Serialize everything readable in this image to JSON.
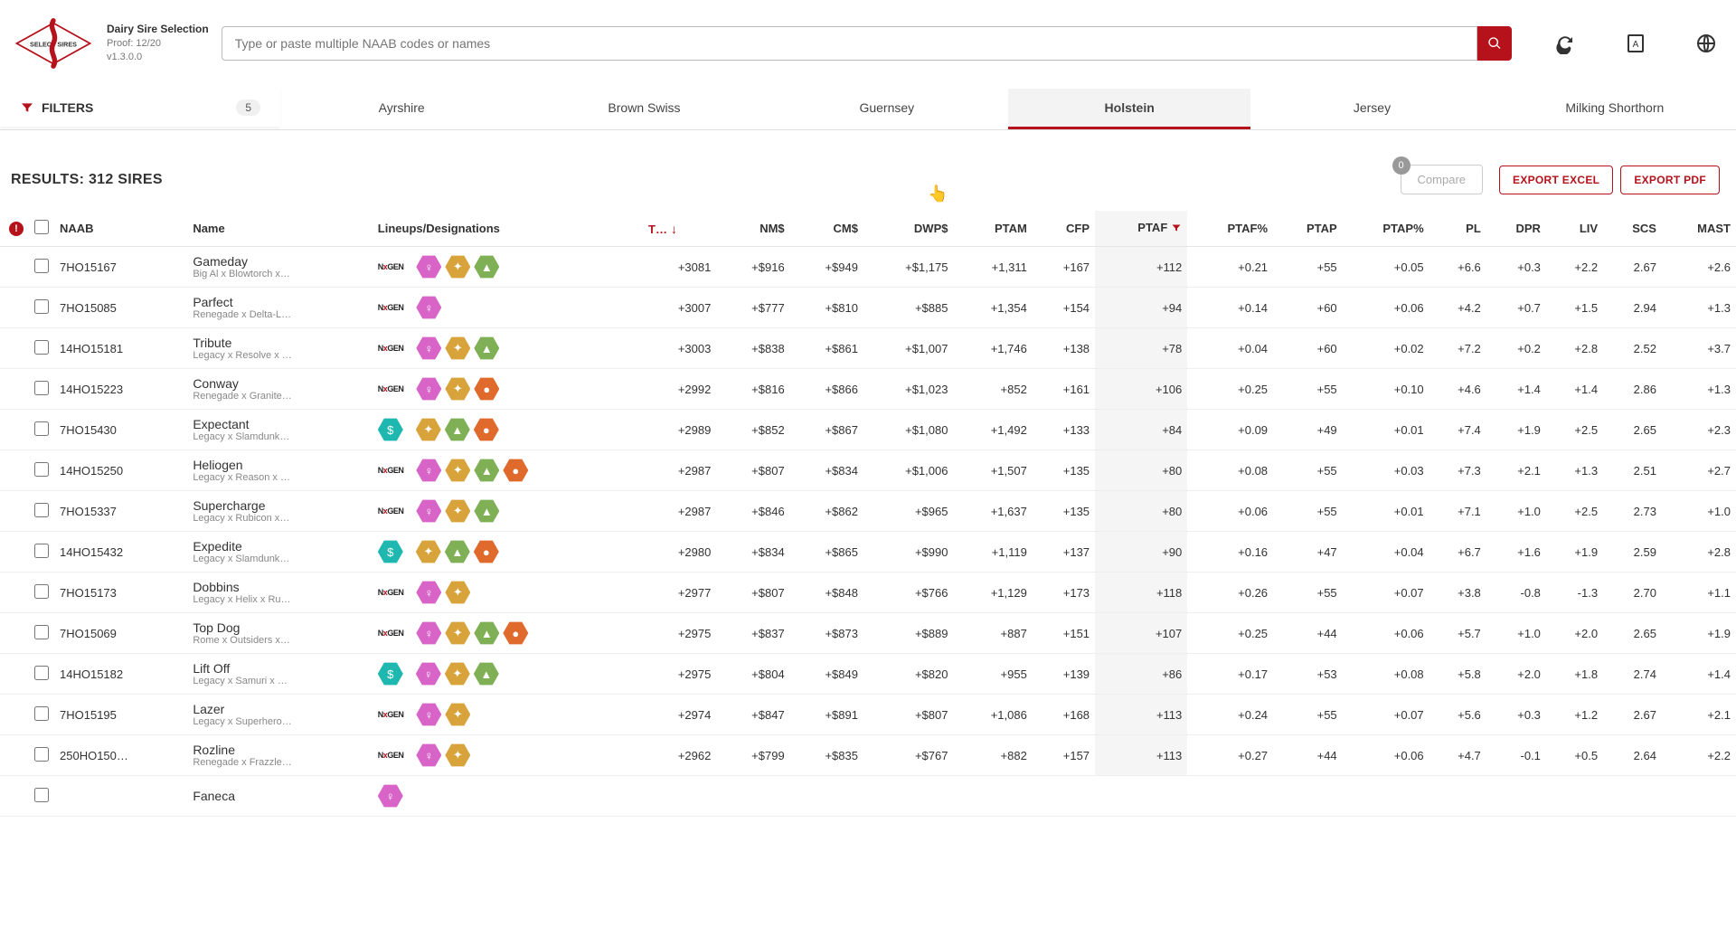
{
  "app": {
    "title": "Dairy Sire Selection",
    "proof": "Proof: 12/20",
    "version": "v1.3.0.0"
  },
  "search": {
    "placeholder": "Type or paste multiple NAAB codes or names"
  },
  "filters": {
    "label": "FILTERS",
    "count": "5"
  },
  "breed_tabs": [
    {
      "label": "Ayrshire",
      "active": false
    },
    {
      "label": "Brown Swiss",
      "active": false
    },
    {
      "label": "Guernsey",
      "active": false
    },
    {
      "label": "Holstein",
      "active": true
    },
    {
      "label": "Jersey",
      "active": false
    },
    {
      "label": "Milking Shorthorn",
      "active": false
    }
  ],
  "results_label": "RESULTS: 312 SIRES",
  "actions": {
    "compare": "Compare",
    "compare_count": "0",
    "export_excel": "EXPORT EXCEL",
    "export_pdf": "EXPORT PDF"
  },
  "columns": [
    {
      "key": "alert",
      "label": ""
    },
    {
      "key": "check",
      "label": ""
    },
    {
      "key": "naab",
      "label": "NAAB"
    },
    {
      "key": "name",
      "label": "Name"
    },
    {
      "key": "lineups",
      "label": "Lineups/Designations"
    },
    {
      "key": "tpi",
      "label": "T…",
      "sorted": "desc"
    },
    {
      "key": "nm",
      "label": "NM$",
      "numeric": true
    },
    {
      "key": "cm",
      "label": "CM$",
      "numeric": true
    },
    {
      "key": "dwp",
      "label": "DWP$",
      "numeric": true
    },
    {
      "key": "ptam",
      "label": "PTAM",
      "numeric": true
    },
    {
      "key": "cfp",
      "label": "CFP",
      "numeric": true
    },
    {
      "key": "ptaf",
      "label": "PTAF",
      "numeric": true,
      "highlighted": true,
      "filtered": true
    },
    {
      "key": "ptafp",
      "label": "PTAF%",
      "numeric": true
    },
    {
      "key": "ptap",
      "label": "PTAP",
      "numeric": true
    },
    {
      "key": "ptapp",
      "label": "PTAP%",
      "numeric": true
    },
    {
      "key": "pl",
      "label": "PL",
      "numeric": true
    },
    {
      "key": "dpr",
      "label": "DPR",
      "numeric": true
    },
    {
      "key": "liv",
      "label": "LIV",
      "numeric": true
    },
    {
      "key": "scs",
      "label": "SCS",
      "numeric": true
    },
    {
      "key": "mast",
      "label": "MAST",
      "numeric": true
    }
  ],
  "rows": [
    {
      "naab": "7HO15167",
      "name": "Gameday",
      "lineage": "Big Al x Blowtorch x …",
      "nlogo": true,
      "badges": [
        "pink",
        "gold",
        "green"
      ],
      "tpi": "+3081",
      "nm": "+$916",
      "cm": "+$949",
      "dwp": "+$1,175",
      "ptam": "+1,311",
      "cfp": "+167",
      "ptaf": "+112",
      "ptafp": "+0.21",
      "ptap": "+55",
      "ptapp": "+0.05",
      "pl": "+6.6",
      "dpr": "+0.3",
      "liv": "+2.2",
      "scs": "2.67",
      "mast": "+2.6"
    },
    {
      "naab": "7HO15085",
      "name": "Parfect",
      "lineage": "Renegade x Delta-La…",
      "nlogo": true,
      "badges": [
        "pink"
      ],
      "tpi": "+3007",
      "nm": "+$777",
      "cm": "+$810",
      "dwp": "+$885",
      "ptam": "+1,354",
      "cfp": "+154",
      "ptaf": "+94",
      "ptafp": "+0.14",
      "ptap": "+60",
      "ptapp": "+0.06",
      "pl": "+4.2",
      "dpr": "+0.7",
      "liv": "+1.5",
      "scs": "2.94",
      "mast": "+1.3"
    },
    {
      "naab": "14HO15181",
      "name": "Tribute",
      "lineage": "Legacy x Resolve x J…",
      "nlogo": true,
      "badges": [
        "pink",
        "gold",
        "green"
      ],
      "tpi": "+3003",
      "nm": "+$838",
      "cm": "+$861",
      "dwp": "+$1,007",
      "ptam": "+1,746",
      "cfp": "+138",
      "ptaf": "+78",
      "ptafp": "+0.04",
      "ptap": "+60",
      "ptapp": "+0.02",
      "pl": "+7.2",
      "dpr": "+0.2",
      "liv": "+2.8",
      "scs": "2.52",
      "mast": "+3.7"
    },
    {
      "naab": "14HO15223",
      "name": "Conway",
      "lineage": "Renegade x Granite …",
      "nlogo": true,
      "badges": [
        "pink",
        "gold",
        "orange"
      ],
      "tpi": "+2992",
      "nm": "+$816",
      "cm": "+$866",
      "dwp": "+$1,023",
      "ptam": "+852",
      "cfp": "+161",
      "ptaf": "+106",
      "ptafp": "+0.25",
      "ptap": "+55",
      "ptapp": "+0.10",
      "pl": "+4.6",
      "dpr": "+1.4",
      "liv": "+1.4",
      "scs": "2.86",
      "mast": "+1.3"
    },
    {
      "naab": "7HO15430",
      "name": "Expectant",
      "lineage": "Legacy x Slamdunk …",
      "nlogo": false,
      "teal": true,
      "badges": [
        "gold",
        "green",
        "orange"
      ],
      "tpi": "+2989",
      "nm": "+$852",
      "cm": "+$867",
      "dwp": "+$1,080",
      "ptam": "+1,492",
      "cfp": "+133",
      "ptaf": "+84",
      "ptafp": "+0.09",
      "ptap": "+49",
      "ptapp": "+0.01",
      "pl": "+7.4",
      "dpr": "+1.9",
      "liv": "+2.5",
      "scs": "2.65",
      "mast": "+2.3"
    },
    {
      "naab": "14HO15250",
      "name": "Heliogen",
      "lineage": "Legacy x Reason x R…",
      "nlogo": true,
      "badges": [
        "pink",
        "gold",
        "green",
        "orange"
      ],
      "tpi": "+2987",
      "nm": "+$807",
      "cm": "+$834",
      "dwp": "+$1,006",
      "ptam": "+1,507",
      "cfp": "+135",
      "ptaf": "+80",
      "ptafp": "+0.08",
      "ptap": "+55",
      "ptapp": "+0.03",
      "pl": "+7.3",
      "dpr": "+2.1",
      "liv": "+1.3",
      "scs": "2.51",
      "mast": "+2.7"
    },
    {
      "naab": "7HO15337",
      "name": "Supercharge",
      "lineage": "Legacy x Rubicon x …",
      "nlogo": true,
      "badges": [
        "pink",
        "gold",
        "green"
      ],
      "tpi": "+2987",
      "nm": "+$846",
      "cm": "+$862",
      "dwp": "+$965",
      "ptam": "+1,637",
      "cfp": "+135",
      "ptaf": "+80",
      "ptafp": "+0.06",
      "ptap": "+55",
      "ptapp": "+0.01",
      "pl": "+7.1",
      "dpr": "+1.0",
      "liv": "+2.5",
      "scs": "2.73",
      "mast": "+1.0"
    },
    {
      "naab": "14HO15432",
      "name": "Expedite",
      "lineage": "Legacy x Slamdunk …",
      "nlogo": false,
      "teal": true,
      "badges": [
        "gold",
        "green",
        "orange"
      ],
      "tpi": "+2980",
      "nm": "+$834",
      "cm": "+$865",
      "dwp": "+$990",
      "ptam": "+1,119",
      "cfp": "+137",
      "ptaf": "+90",
      "ptafp": "+0.16",
      "ptap": "+47",
      "ptapp": "+0.04",
      "pl": "+6.7",
      "dpr": "+1.6",
      "liv": "+1.9",
      "scs": "2.59",
      "mast": "+2.8"
    },
    {
      "naab": "7HO15173",
      "name": "Dobbins",
      "lineage": "Legacy x Helix x Rub…",
      "nlogo": true,
      "badges": [
        "pink",
        "gold"
      ],
      "tpi": "+2977",
      "nm": "+$807",
      "cm": "+$848",
      "dwp": "+$766",
      "ptam": "+1,129",
      "cfp": "+173",
      "ptaf": "+118",
      "ptafp": "+0.26",
      "ptap": "+55",
      "ptapp": "+0.07",
      "pl": "+3.8",
      "dpr": "-0.8",
      "liv": "-1.3",
      "scs": "2.70",
      "mast": "+1.1"
    },
    {
      "naab": "7HO15069",
      "name": "Top Dog",
      "lineage": "Rome x Outsiders x …",
      "nlogo": true,
      "badges": [
        "pink",
        "gold",
        "green",
        "orange"
      ],
      "tpi": "+2975",
      "nm": "+$837",
      "cm": "+$873",
      "dwp": "+$889",
      "ptam": "+887",
      "cfp": "+151",
      "ptaf": "+107",
      "ptafp": "+0.25",
      "ptap": "+44",
      "ptapp": "+0.06",
      "pl": "+5.7",
      "dpr": "+1.0",
      "liv": "+2.0",
      "scs": "2.65",
      "mast": "+1.9"
    },
    {
      "naab": "14HO15182",
      "name": "Lift Off",
      "lineage": "Legacy x Samuri x S…",
      "nlogo": false,
      "teal": true,
      "badges": [
        "pink",
        "gold",
        "green"
      ],
      "tpi": "+2975",
      "nm": "+$804",
      "cm": "+$849",
      "dwp": "+$820",
      "ptam": "+955",
      "cfp": "+139",
      "ptaf": "+86",
      "ptafp": "+0.17",
      "ptap": "+53",
      "ptapp": "+0.08",
      "pl": "+5.8",
      "dpr": "+2.0",
      "liv": "+1.8",
      "scs": "2.74",
      "mast": "+1.4"
    },
    {
      "naab": "7HO15195",
      "name": "Lazer",
      "lineage": "Legacy x Superhero …",
      "nlogo": true,
      "badges": [
        "pink",
        "gold"
      ],
      "tpi": "+2974",
      "nm": "+$847",
      "cm": "+$891",
      "dwp": "+$807",
      "ptam": "+1,086",
      "cfp": "+168",
      "ptaf": "+113",
      "ptafp": "+0.24",
      "ptap": "+55",
      "ptapp": "+0.07",
      "pl": "+5.6",
      "dpr": "+0.3",
      "liv": "+1.2",
      "scs": "2.67",
      "mast": "+2.1"
    },
    {
      "naab": "250HO150…",
      "name": "Rozline",
      "lineage": "Renegade x Frazzled…",
      "nlogo": true,
      "badges": [
        "pink",
        "gold"
      ],
      "tpi": "+2962",
      "nm": "+$799",
      "cm": "+$835",
      "dwp": "+$767",
      "ptam": "+882",
      "cfp": "+157",
      "ptaf": "+113",
      "ptafp": "+0.27",
      "ptap": "+44",
      "ptapp": "+0.06",
      "pl": "+4.7",
      "dpr": "-0.1",
      "liv": "+0.5",
      "scs": "2.64",
      "mast": "+2.2"
    }
  ],
  "partial_row": {
    "name": "Faneca"
  }
}
